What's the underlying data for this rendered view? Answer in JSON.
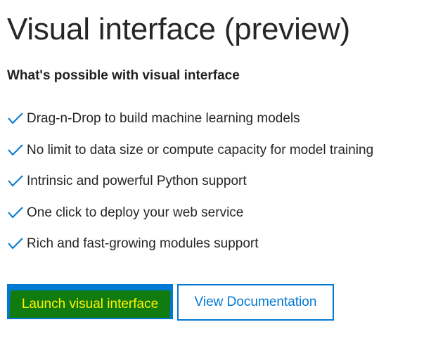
{
  "page": {
    "title": "Visual interface (preview)",
    "subtitle": "What's possible with visual interface"
  },
  "features": [
    {
      "icon": "checkmark-icon",
      "text": "Drag-n-Drop to build machine learning models"
    },
    {
      "icon": "checkmark-icon",
      "text": "No limit to data size or compute capacity for model training"
    },
    {
      "icon": "checkmark-icon",
      "text": "Intrinsic and powerful Python support"
    },
    {
      "icon": "checkmark-icon",
      "text": "One click to deploy your web service"
    },
    {
      "icon": "checkmark-icon",
      "text": "Rich and fast-growing modules support"
    }
  ],
  "actions": {
    "launch_label": "Launch visual interface",
    "docs_label": "View Documentation"
  },
  "colors": {
    "accent": "#0078d4",
    "highlight_fill": "#107c10",
    "highlight_text": "#fff100",
    "text": "#262626"
  }
}
